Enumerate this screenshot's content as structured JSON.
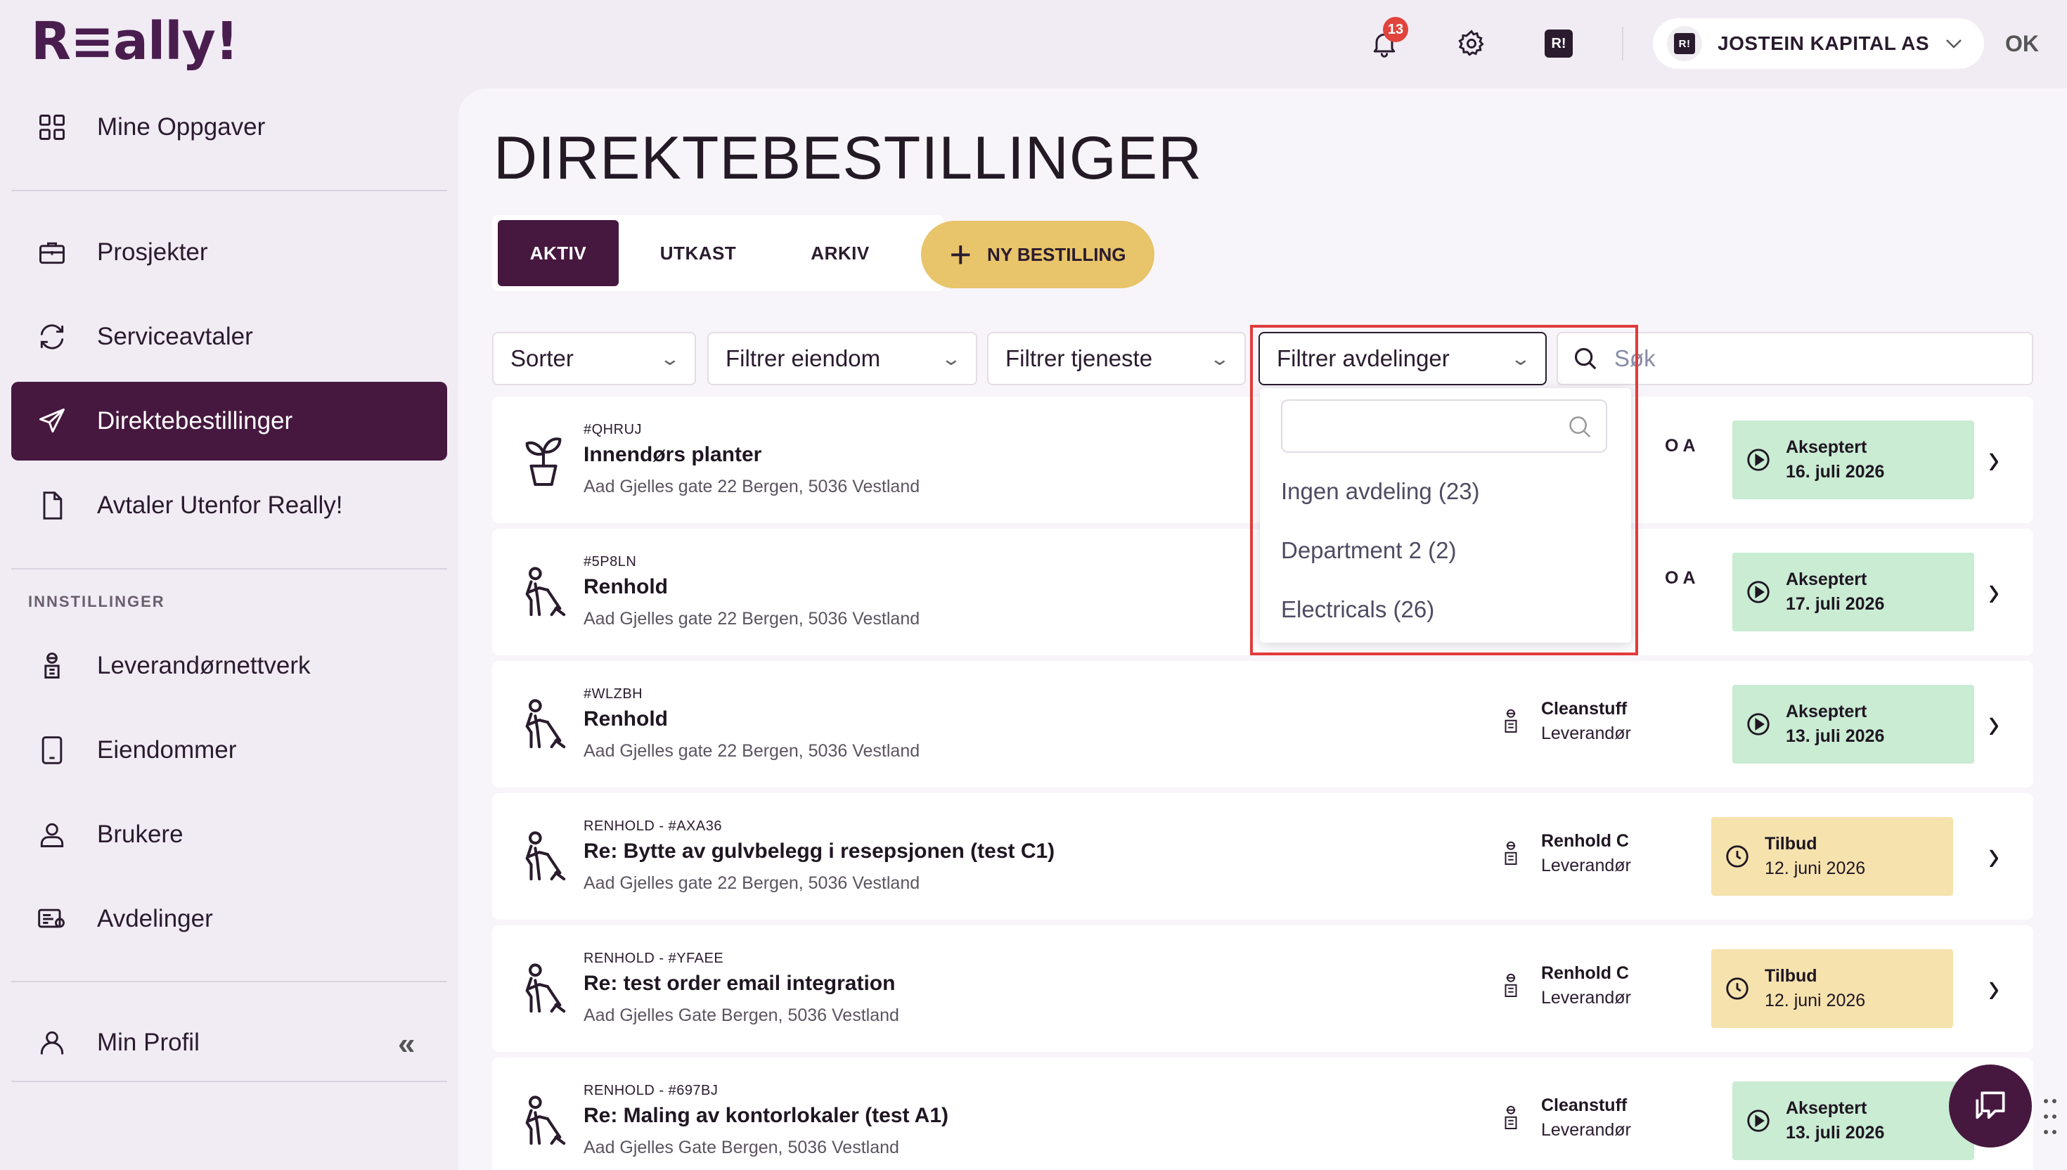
{
  "app": {
    "logo": "R≡ally!"
  },
  "topbar": {
    "notifications_count": "13",
    "r_badge": "R!",
    "company_name": "JOSTEIN KAPITAL AS",
    "ok_label": "OK"
  },
  "sidebar": {
    "items": [
      {
        "label": "Mine Oppgaver",
        "icon": "grid-icon"
      },
      {
        "label": "Prosjekter",
        "icon": "briefcase-icon"
      },
      {
        "label": "Serviceavtaler",
        "icon": "refresh-icon"
      },
      {
        "label": "Direktebestillinger",
        "icon": "send-icon"
      },
      {
        "label": "Avtaler Utenfor Really!",
        "icon": "document-icon"
      },
      {
        "label": "Leverandørnettverk",
        "icon": "worker-icon"
      },
      {
        "label": "Eiendommer",
        "icon": "building-icon"
      },
      {
        "label": "Brukere",
        "icon": "user-icon"
      },
      {
        "label": "Avdelinger",
        "icon": "department-icon"
      },
      {
        "label": "Min Profil",
        "icon": "profile-icon"
      }
    ],
    "section_label": "INNSTILLINGER",
    "collapse_label": "«"
  },
  "main": {
    "title": "DIREKTEBESTILLINGER",
    "tabs": [
      "AKTIV",
      "UTKAST",
      "ARKIV"
    ],
    "new_button": "NY BESTILLING",
    "filters": {
      "sort": "Sorter",
      "property": "Filtrer eiendom",
      "service": "Filtrer tjeneste",
      "department": "Filtrer avdelinger",
      "search_placeholder": "Søk"
    },
    "dropdown": {
      "options": [
        "Ingen avdeling (23)",
        "Department 2 (2)",
        "Electricals (26)"
      ]
    },
    "rows": [
      {
        "code": "#QHRUJ",
        "title": "Innendørs planter",
        "address": "Aad Gjelles gate 22 Bergen, 5036 Vestland",
        "supplier": "",
        "role": "",
        "partial": "O A",
        "status": "Akseptert",
        "date": "16. juli 2026",
        "state": "accepted",
        "icon": "plant-icon"
      },
      {
        "code": "#5P8LN",
        "title": "Renhold",
        "address": "Aad Gjelles gate 22 Bergen, 5036 Vestland",
        "supplier": "",
        "role": "",
        "partial": "O A",
        "status": "Akseptert",
        "date": "17. juli 2026",
        "state": "accepted",
        "icon": "cleaning-icon"
      },
      {
        "code": "#WLZBH",
        "title": "Renhold",
        "address": "Aad Gjelles gate 22 Bergen, 5036 Vestland",
        "supplier": "Cleanstuff",
        "role": "Leverandør",
        "partial": "",
        "status": "Akseptert",
        "date": "13. juli 2026",
        "state": "accepted",
        "icon": "cleaning-icon"
      },
      {
        "code": "RENHOLD - #AXA36",
        "title": "Re: Bytte av gulvbelegg i resepsjonen (test C1)",
        "address": "Aad Gjelles gate 22 Bergen, 5036 Vestland",
        "supplier": "Renhold C",
        "role": "Leverandør",
        "partial": "",
        "status": "Tilbud",
        "date": "12. juni 2026",
        "state": "offer",
        "icon": "cleaning-icon"
      },
      {
        "code": "RENHOLD - #YFAEE",
        "title": "Re: test order email integration",
        "address": "Aad Gjelles Gate Bergen, 5036 Vestland",
        "supplier": "Renhold C",
        "role": "Leverandør",
        "partial": "",
        "status": "Tilbud",
        "date": "12. juni 2026",
        "state": "offer",
        "icon": "cleaning-icon"
      },
      {
        "code": "RENHOLD - #697BJ",
        "title": "Re: Maling av kontorlokaler (test A1)",
        "address": "Aad Gjelles Gate Bergen, 5036 Vestland",
        "supplier": "Cleanstuff",
        "role": "Leverandør",
        "partial": "",
        "status": "Akseptert",
        "date": "13. juli 2026",
        "state": "accepted",
        "icon": "cleaning-icon"
      }
    ]
  },
  "colors": {
    "brand": "#46183f",
    "accent": "#e8c46a",
    "accepted": "#c9ecd3",
    "offer": "#f6e2ad",
    "highlight": "#e23b3b"
  }
}
